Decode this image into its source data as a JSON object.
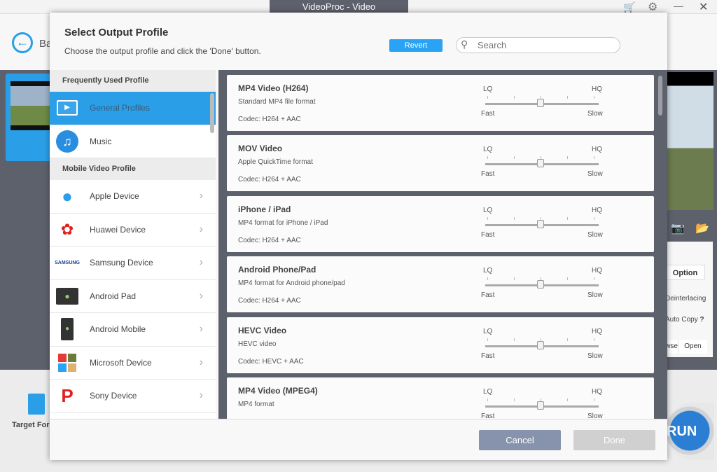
{
  "window": {
    "title": "VideoProc - Video",
    "back_label": "Back"
  },
  "background": {
    "target_format": "Target Format",
    "option": "Option",
    "deinterlacing": "Deinterlacing",
    "auto_copy": "Auto Copy",
    "help": "?",
    "browse": "Browse",
    "open": "Open",
    "run": "RUN"
  },
  "modal": {
    "title": "Select Output Profile",
    "subtitle": "Choose the output profile and click the 'Done' button.",
    "revert": "Revert",
    "search_placeholder": "Search",
    "cancel": "Cancel",
    "done": "Done"
  },
  "sidebar": {
    "sections": [
      "Frequently Used Profile",
      "Mobile Video Profile"
    ],
    "items": [
      {
        "label": "General Profiles",
        "icon": "monitor-icon",
        "selected": true
      },
      {
        "label": "Music",
        "icon": "music-icon"
      },
      {
        "label": "Apple Device",
        "icon": "apple-icon"
      },
      {
        "label": "Huawei Device",
        "icon": "huawei-icon"
      },
      {
        "label": "Samsung Device",
        "icon": "samsung-icon",
        "logo_text": "SAMSUNG"
      },
      {
        "label": "Android Pad",
        "icon": "android-pad-icon"
      },
      {
        "label": "Android Mobile",
        "icon": "android-mobile-icon"
      },
      {
        "label": "Microsoft Device",
        "icon": "microsoft-icon"
      },
      {
        "label": "Sony Device",
        "icon": "playstation-icon"
      }
    ]
  },
  "quality": {
    "lq": "LQ",
    "hq": "HQ",
    "fast": "Fast",
    "slow": "Slow",
    "level": 3,
    "levels": 5
  },
  "profiles": [
    {
      "title": "MP4 Video (H264)",
      "desc": "Standard MP4 file format",
      "codec": "Codec: H264 + AAC"
    },
    {
      "title": "MOV Video",
      "desc": "Apple QuickTime format",
      "codec": "Codec: H264 + AAC"
    },
    {
      "title": "iPhone / iPad",
      "desc": "MP4 format for iPhone / iPad",
      "codec": "Codec: H264 + AAC"
    },
    {
      "title": "Android Phone/Pad",
      "desc": "MP4 format for Android phone/pad",
      "codec": "Codec: H264 + AAC"
    },
    {
      "title": "HEVC Video",
      "desc": "HEVC video",
      "codec": "Codec: HEVC + AAC"
    },
    {
      "title": "MP4 Video (MPEG4)",
      "desc": "MP4 format",
      "codec": ""
    }
  ],
  "colors": {
    "accent": "#2a9fe8",
    "cancel": "#8793ad",
    "done_disabled": "#d0d0d0",
    "cart": "#e53935"
  }
}
